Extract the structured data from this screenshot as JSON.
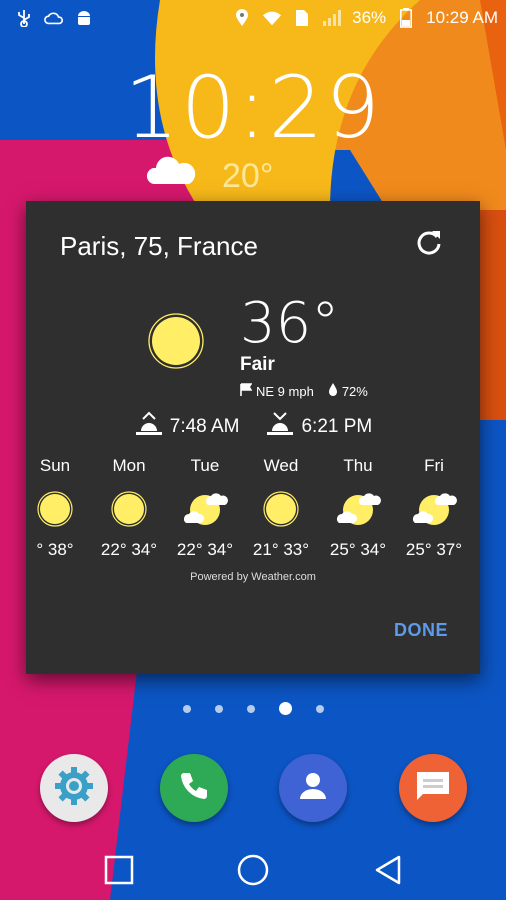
{
  "status_bar": {
    "battery_percent": "36%",
    "time": "10:29 AM",
    "left_icons": [
      "usb-icon",
      "cloud-icon",
      "android-icon"
    ],
    "right_icons": [
      "location-icon",
      "wifi-icon",
      "sim-icon",
      "signal-icon",
      "battery-icon"
    ]
  },
  "lockscreen": {
    "clock": "10:29",
    "weather_temp": "20°"
  },
  "weather_card": {
    "location": "Paris, 75, France",
    "current": {
      "temperature": "36°",
      "condition": "Fair",
      "wind": "NE 9 mph",
      "humidity": "72%"
    },
    "sunrise": "7:48 AM",
    "sunset": "6:21 PM",
    "forecast": [
      {
        "day": "Sun",
        "temps": "° 38°",
        "icon": "sun-icon"
      },
      {
        "day": "Mon",
        "temps": "22° 34°",
        "icon": "sun-icon"
      },
      {
        "day": "Tue",
        "temps": "22° 34°",
        "icon": "partly-cloudy-icon"
      },
      {
        "day": "Wed",
        "temps": "21° 33°",
        "icon": "sun-icon"
      },
      {
        "day": "Thu",
        "temps": "25° 34°",
        "icon": "partly-cloudy-icon"
      },
      {
        "day": "Fri",
        "temps": "25° 37°",
        "icon": "partly-cloudy-icon"
      }
    ],
    "powered_by": "Powered by Weather.com",
    "done_label": "DONE"
  },
  "page_indicator": {
    "count": 5,
    "active_index": 3
  },
  "dock": [
    "settings-icon",
    "phone-icon",
    "contacts-icon",
    "messages-icon"
  ],
  "nav_bar": [
    "recents-button",
    "home-button",
    "back-button"
  ],
  "colors": {
    "card_bg": "#2f2f2f",
    "accent_done": "#5d9bea",
    "sun": "#ffee66",
    "wall_blue": "#0c55c4",
    "wall_pink": "#d6186c",
    "wall_orange": "#f08a1c",
    "wall_yellow": "#f7b81a"
  }
}
